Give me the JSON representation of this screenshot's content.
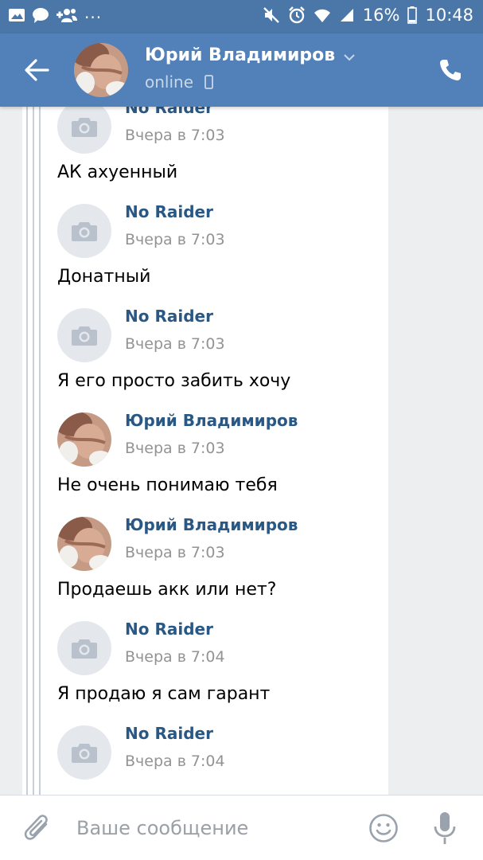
{
  "statusbar": {
    "more": "...",
    "battery_pct": "16%",
    "time": "10:48"
  },
  "header": {
    "contact_name": "Юрий Владимиров",
    "status": "online"
  },
  "messages": [
    {
      "author": "No Raider",
      "time": "Вчера в 7:03",
      "text": "АК ахуенный",
      "avatar": "camera-placeholder"
    },
    {
      "author": "No Raider",
      "time": "Вчера в 7:03",
      "text": "Донатный",
      "avatar": "camera-placeholder"
    },
    {
      "author": "No Raider",
      "time": "Вчера в 7:03",
      "text": "Я его просто забить хочу",
      "avatar": "camera-placeholder"
    },
    {
      "author": "Юрий Владимиров",
      "time": "Вчера в 7:03",
      "text": "Не очень понимаю тебя",
      "avatar": "photo"
    },
    {
      "author": "Юрий Владимиров",
      "time": "Вчера в 7:03",
      "text": "Продаешь акк или нет?",
      "avatar": "photo"
    },
    {
      "author": "No Raider",
      "time": "Вчера в 7:04",
      "text": "Я продаю я сам гарант",
      "avatar": "camera-placeholder"
    },
    {
      "author": "No Raider",
      "time": "Вчера в 7:04",
      "text": "",
      "avatar": "camera-placeholder"
    }
  ],
  "composer": {
    "placeholder": "Ваше сообщение"
  },
  "colors": {
    "header": "#5181b8",
    "statusbar": "#4a76a8",
    "author": "#2a5885",
    "timestamp": "#939393",
    "background": "#edeef0"
  }
}
